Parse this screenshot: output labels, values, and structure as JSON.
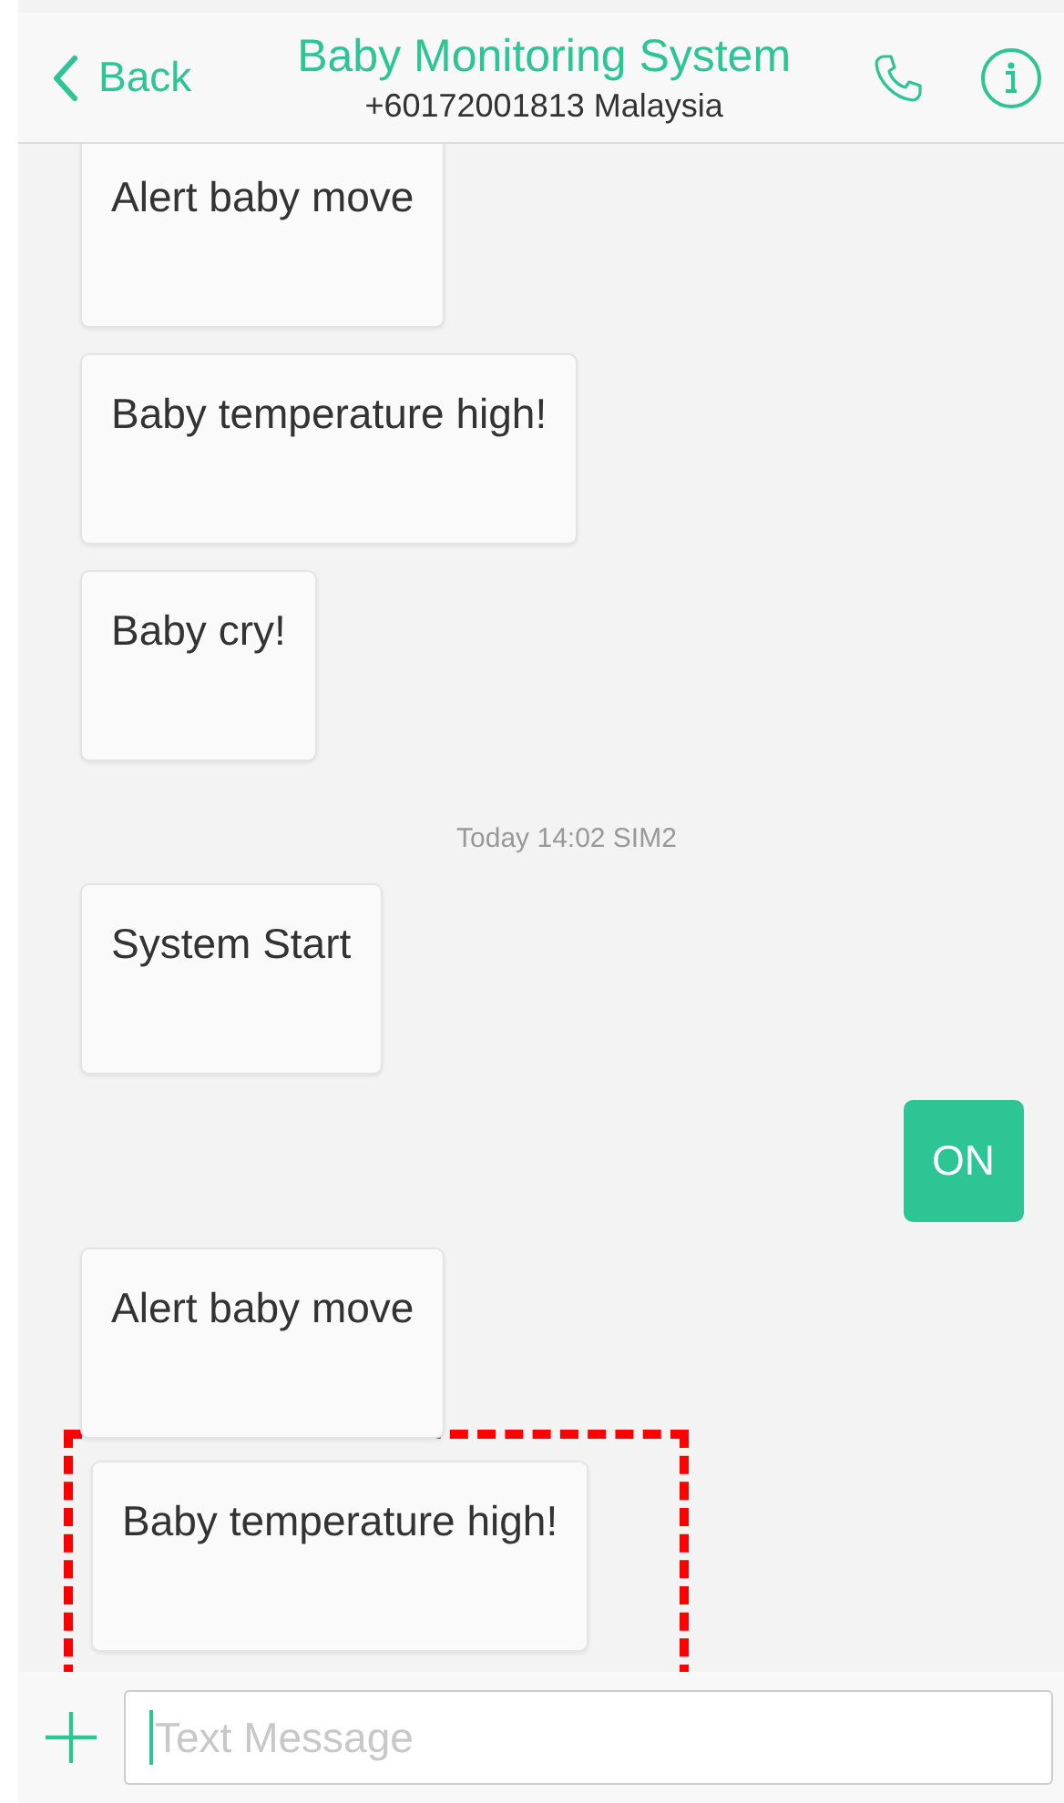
{
  "header": {
    "back_label": "Back",
    "title": "Baby Monitoring System",
    "subtitle": "+60172001813  Malaysia"
  },
  "messages": [
    {
      "kind": "incoming",
      "text": "Alert baby move",
      "highlighted": false
    },
    {
      "kind": "incoming",
      "text": "Baby temperature high!",
      "highlighted": false
    },
    {
      "kind": "incoming",
      "text": "Baby cry!",
      "highlighted": false
    },
    {
      "kind": "timestamp",
      "text": "Today 14:02  SIM2"
    },
    {
      "kind": "incoming",
      "text": "System Start",
      "highlighted": false
    },
    {
      "kind": "outgoing",
      "text": "ON",
      "highlighted": false
    },
    {
      "kind": "incoming",
      "text": "Alert baby move",
      "highlighted": false
    },
    {
      "kind": "incoming",
      "text": "Baby temperature high!",
      "highlighted": true
    }
  ],
  "composer": {
    "placeholder": "Text Message"
  }
}
